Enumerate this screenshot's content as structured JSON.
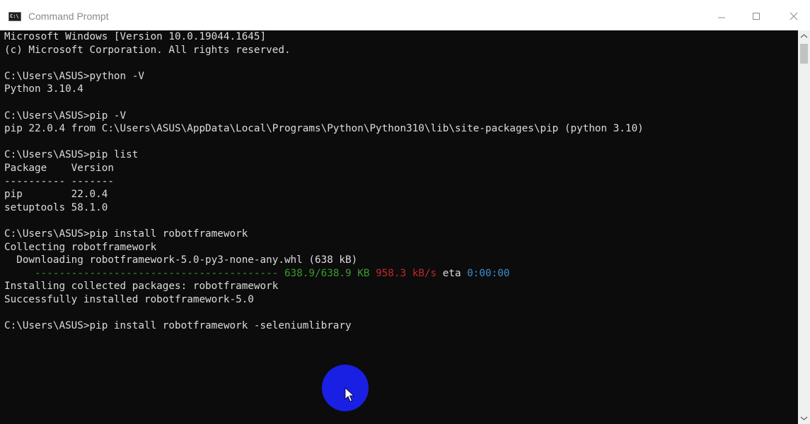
{
  "window": {
    "title": "Command Prompt",
    "icon_text": "C:\\",
    "controls": [
      "minimize-icon",
      "maximize-icon",
      "close-icon"
    ]
  },
  "terminal": {
    "lines": [
      {
        "text": "Microsoft Windows [Version 10.0.19044.1645]"
      },
      {
        "text": "(c) Microsoft Corporation. All rights reserved."
      },
      {
        "text": ""
      },
      {
        "text": "C:\\Users\\ASUS>python -V"
      },
      {
        "text": "Python 3.10.4"
      },
      {
        "text": ""
      },
      {
        "text": "C:\\Users\\ASUS>pip -V"
      },
      {
        "text": "pip 22.0.4 from C:\\Users\\ASUS\\AppData\\Local\\Programs\\Python\\Python310\\lib\\site-packages\\pip (python 3.10)"
      },
      {
        "text": ""
      },
      {
        "text": "C:\\Users\\ASUS>pip list"
      },
      {
        "text": "Package    Version"
      },
      {
        "text": "---------- -------"
      },
      {
        "text": "pip        22.0.4"
      },
      {
        "text": "setuptools 58.1.0"
      },
      {
        "text": ""
      },
      {
        "text": "C:\\Users\\ASUS>pip install robotframework"
      },
      {
        "text": "Collecting robotframework"
      },
      {
        "text": "  Downloading robotframework-5.0-py3-none-any.whl (638 kB)"
      },
      {
        "segments": [
          {
            "text": "     ---------------------------------------- ",
            "color": "green"
          },
          {
            "text": "638.9/638.9 KB",
            "color": "green"
          },
          {
            "text": " "
          },
          {
            "text": "958.3 kB/s",
            "color": "red"
          },
          {
            "text": " eta "
          },
          {
            "text": "0:00:00",
            "color": "cyan"
          }
        ]
      },
      {
        "text": "Installing collected packages: robotframework"
      },
      {
        "text": "Successfully installed robotframework-5.0"
      },
      {
        "text": ""
      },
      {
        "text": "C:\\Users\\ASUS>pip install robotframework -seleniumlibrary"
      }
    ]
  },
  "colors": {
    "background": "#0c0c0c",
    "text": "#dcdcdc",
    "green": "#3a9a2f",
    "red": "#c0282b",
    "cyan": "#3b8ed1",
    "cursor_highlight": "#1a1fe4"
  }
}
